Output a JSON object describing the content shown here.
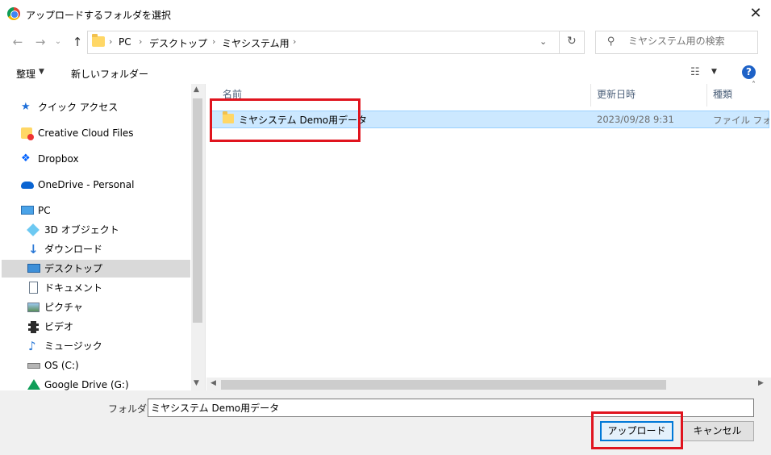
{
  "window": {
    "title": "アップロードするフォルダを選択",
    "close_glyph": "✕"
  },
  "addressbar": {
    "breadcrumbs": [
      "PC",
      "デスクトップ",
      "ミヤシステム用"
    ],
    "separator": "›",
    "search_placeholder": "ミヤシステム用の検索"
  },
  "toolbar": {
    "organize_label": "整理",
    "new_folder_label": "新しいフォルダー"
  },
  "navpane": {
    "items": [
      {
        "label": "クイック アクセス",
        "icon": "star-icon"
      },
      {
        "label": "Creative Cloud Files",
        "icon": "creative-cloud-icon"
      },
      {
        "label": "Dropbox",
        "icon": "dropbox-icon"
      },
      {
        "label": "OneDrive - Personal",
        "icon": "onedrive-icon"
      },
      {
        "label": "PC",
        "icon": "pc-icon"
      },
      {
        "label": "3D オブジェクト",
        "icon": "3d-objects-icon"
      },
      {
        "label": "ダウンロード",
        "icon": "download-icon"
      },
      {
        "label": "デスクトップ",
        "icon": "desktop-icon"
      },
      {
        "label": "ドキュメント",
        "icon": "documents-icon"
      },
      {
        "label": "ピクチャ",
        "icon": "pictures-icon"
      },
      {
        "label": "ビデオ",
        "icon": "videos-icon"
      },
      {
        "label": "ミュージック",
        "icon": "music-icon"
      },
      {
        "label": "OS (C:)",
        "icon": "drive-icon"
      },
      {
        "label": "Google Drive (G:)",
        "icon": "google-drive-icon"
      }
    ],
    "selected": "デスクトップ"
  },
  "filelist": {
    "columns": [
      "名前",
      "更新日時",
      "種類"
    ],
    "rows": [
      {
        "name": "ミヤシステム Demo用データ",
        "modified": "2023/09/28 9:31",
        "type": "ファイル フォルダー"
      }
    ]
  },
  "footer": {
    "folder_label": "フォルダー:",
    "folder_value": "ミヤシステム Demo用データ",
    "upload_label": "アップロード",
    "cancel_label": "キャンセル"
  },
  "colors": {
    "selection": "#cce8ff",
    "annotation": "#e0141e",
    "accent": "#0078d7"
  }
}
